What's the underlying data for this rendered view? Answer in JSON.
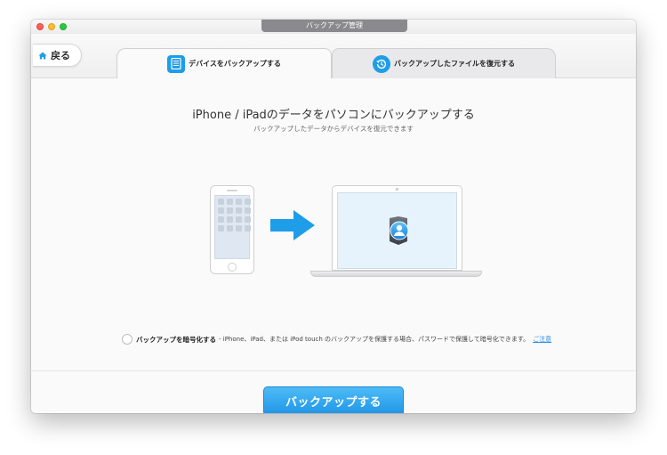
{
  "window": {
    "title": "バックアップ管理"
  },
  "toolbar": {
    "back_label": "戻る",
    "back_icon": "home-icon",
    "tabs": [
      {
        "label": "デバイスをバックアップする",
        "icon": "document-icon",
        "active": true
      },
      {
        "label": "バックアップしたファイルを復元する",
        "icon": "restore-clock-icon",
        "active": false
      }
    ]
  },
  "main": {
    "headline": "iPhone / iPadのデータをパソコンにバックアップする",
    "subline": "バックアップしたデータからデバイスを復元できます",
    "illustration": {
      "source_device": "iphone-icon",
      "arrow": "right-arrow-icon",
      "target_device": "laptop-icon",
      "app_badge": "app-logo-icon"
    }
  },
  "encryption": {
    "checked": false,
    "label": "バックアップを暗号化する",
    "description": "- iPhone、iPad、または iPod touch のバックアップを保護する場合、パスワードで保護して暗号化できます。",
    "link": "ご注意"
  },
  "actions": {
    "primary_label": "バックアップする"
  },
  "colors": {
    "accent": "#1e9de8",
    "button_top": "#4dbbf6",
    "button_bottom": "#1f95e6",
    "link": "#2a8ee6"
  }
}
